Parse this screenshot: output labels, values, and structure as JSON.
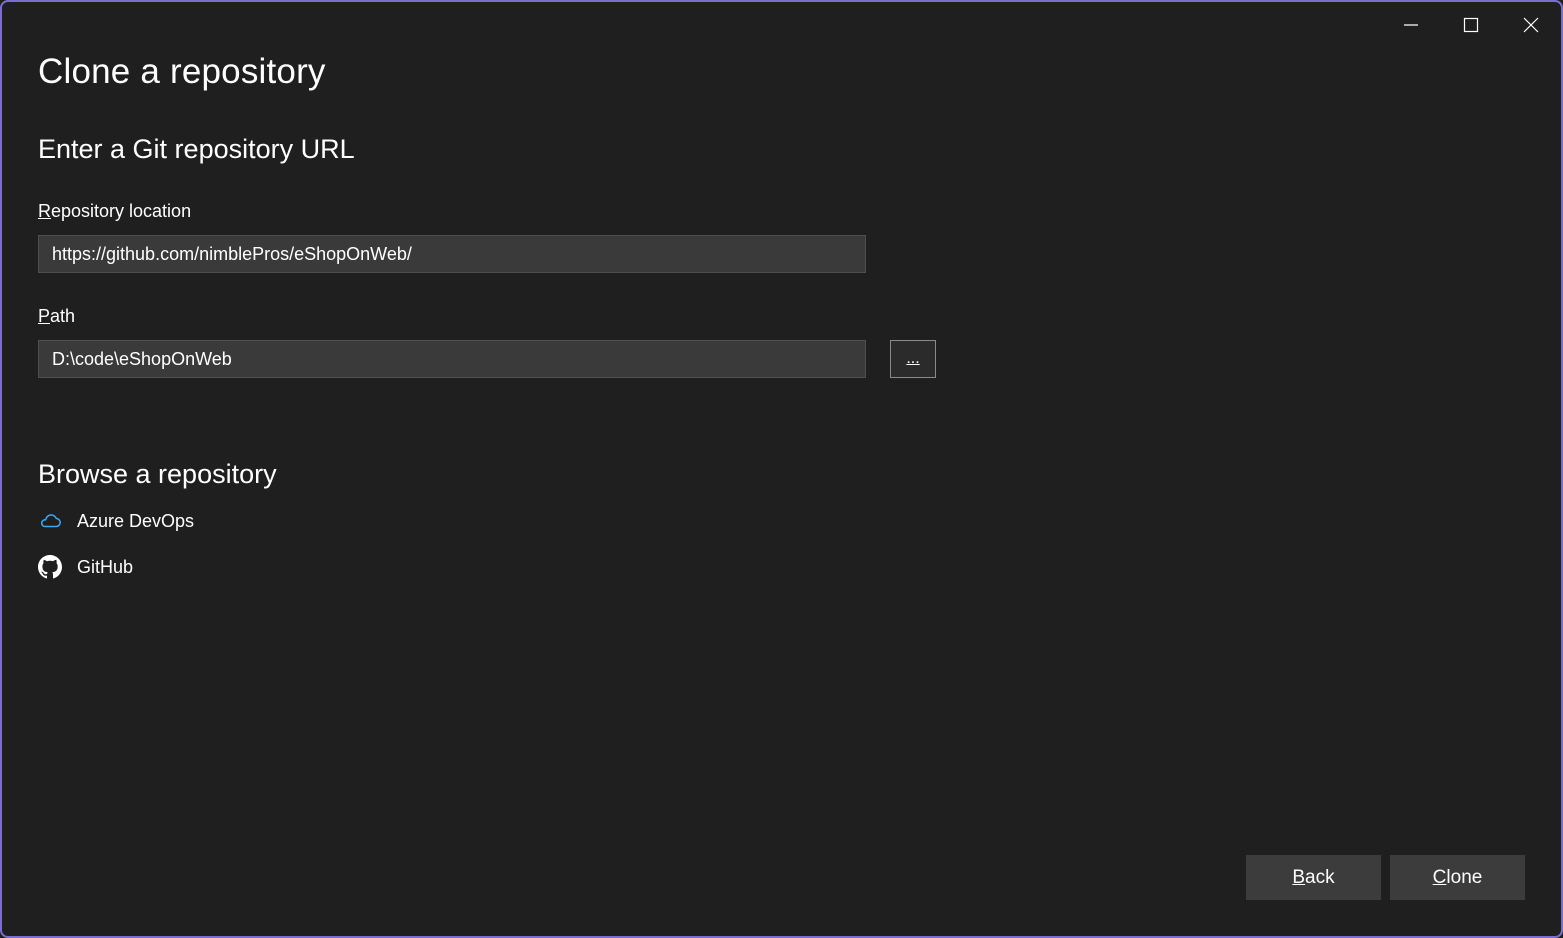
{
  "window": {
    "controls": {
      "minimize": "minimize-icon",
      "maximize": "maximize-icon",
      "close": "close-icon"
    },
    "border_color": "#7a6fd1",
    "background": "#1f1f1f"
  },
  "page_title": "Clone a repository",
  "url_section": {
    "heading": "Enter a Git repository URL",
    "repo_location": {
      "label_mnemonic": "R",
      "label_rest": "epository location",
      "value": "https://github.com/nimblePros/eShopOnWeb/"
    },
    "path": {
      "label_mnemonic": "P",
      "label_rest": "ath",
      "value": "D:\\code\\eShopOnWeb",
      "browse_label": "..."
    }
  },
  "browse_section": {
    "heading": "Browse a repository",
    "providers": [
      {
        "label": "Azure DevOps",
        "icon": "cloud-icon",
        "icon_color": "#3ea8f5"
      },
      {
        "label": "GitHub",
        "icon": "github-icon",
        "icon_color": "#ffffff"
      }
    ]
  },
  "footer": {
    "back": {
      "mnemonic": "B",
      "rest": "ack"
    },
    "clone": {
      "mnemonic": "C",
      "rest": "lone"
    }
  }
}
